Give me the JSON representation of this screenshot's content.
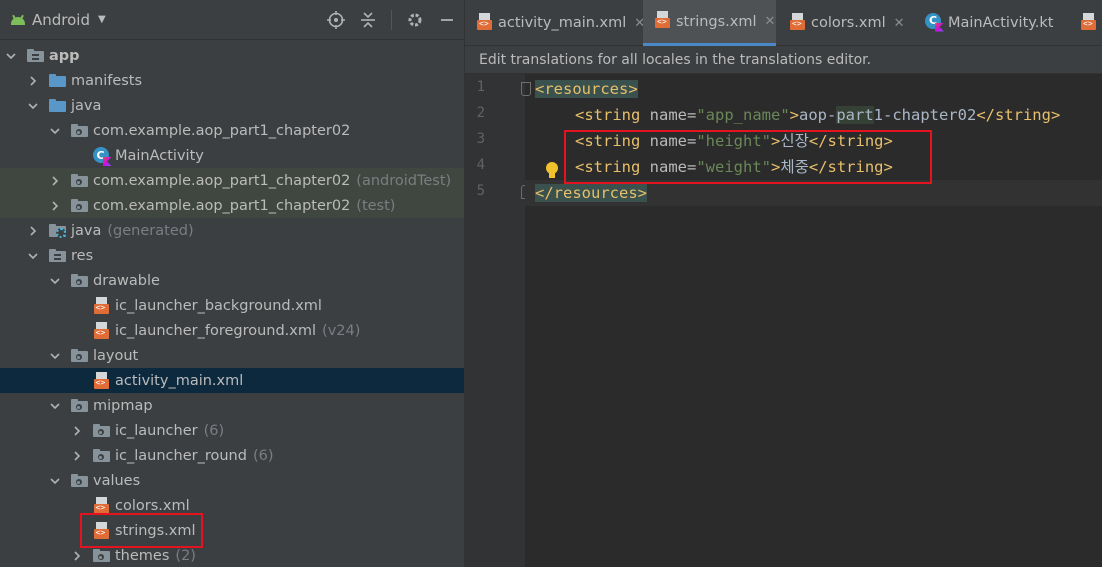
{
  "project_panel": {
    "view_label": "Android",
    "tree": [
      {
        "label": "app",
        "hint": "",
        "icon": "module-folder-icon",
        "depth": 0,
        "expanded": true,
        "bold": true
      },
      {
        "label": "manifests",
        "hint": "",
        "icon": "folder-icon",
        "depth": 1,
        "expanded": false
      },
      {
        "label": "java",
        "hint": "",
        "icon": "source-folder-icon",
        "depth": 1,
        "expanded": true
      },
      {
        "label": "com.example.aop_part1_chapter02",
        "hint": "",
        "icon": "package-icon",
        "depth": 2,
        "expanded": true
      },
      {
        "label": "MainActivity",
        "hint": "",
        "icon": "kotlin-class-icon",
        "depth": 3,
        "leaf": true
      },
      {
        "label": "com.example.aop_part1_chapter02",
        "hint": "(androidTest)",
        "icon": "package-icon",
        "depth": 2,
        "expanded": false,
        "test": true
      },
      {
        "label": "com.example.aop_part1_chapter02",
        "hint": "(test)",
        "icon": "package-icon",
        "depth": 2,
        "expanded": false,
        "test": true
      },
      {
        "label": "java",
        "hint": "(generated)",
        "icon": "generated-folder-icon",
        "depth": 1,
        "expanded": false
      },
      {
        "label": "res",
        "hint": "",
        "icon": "resources-folder-icon",
        "depth": 1,
        "expanded": true
      },
      {
        "label": "drawable",
        "hint": "",
        "icon": "package-icon",
        "depth": 2,
        "expanded": true
      },
      {
        "label": "ic_launcher_background.xml",
        "hint": "",
        "icon": "xml-file-icon",
        "depth": 3,
        "leaf": true
      },
      {
        "label": "ic_launcher_foreground.xml",
        "hint": "(v24)",
        "icon": "xml-file-icon",
        "depth": 3,
        "leaf": true
      },
      {
        "label": "layout",
        "hint": "",
        "icon": "package-icon",
        "depth": 2,
        "expanded": true
      },
      {
        "label": "activity_main.xml",
        "hint": "",
        "icon": "xml-file-icon",
        "depth": 3,
        "leaf": true,
        "selected": true
      },
      {
        "label": "mipmap",
        "hint": "",
        "icon": "package-icon",
        "depth": 2,
        "expanded": true
      },
      {
        "label": "ic_launcher",
        "hint": "(6)",
        "icon": "package-icon",
        "depth": 3,
        "expanded": false
      },
      {
        "label": "ic_launcher_round",
        "hint": "(6)",
        "icon": "package-icon",
        "depth": 3,
        "expanded": false
      },
      {
        "label": "values",
        "hint": "",
        "icon": "package-icon",
        "depth": 2,
        "expanded": true
      },
      {
        "label": "colors.xml",
        "hint": "",
        "icon": "xml-file-icon",
        "depth": 3,
        "leaf": true
      },
      {
        "label": "strings.xml",
        "hint": "",
        "icon": "xml-file-icon",
        "depth": 3,
        "leaf": true,
        "highlighted": true
      },
      {
        "label": "themes",
        "hint": "(2)",
        "icon": "package-icon",
        "depth": 3,
        "expanded": false
      }
    ]
  },
  "editor": {
    "tabs": [
      {
        "label": "activity_main.xml",
        "icon": "xml-file-icon",
        "active": false,
        "closable": true
      },
      {
        "label": "strings.xml",
        "icon": "xml-file-icon",
        "active": true,
        "closable": true
      },
      {
        "label": "colors.xml",
        "icon": "xml-file-icon",
        "active": false,
        "closable": true
      },
      {
        "label": "MainActivity.kt",
        "icon": "kotlin-class-icon",
        "active": false,
        "closable": false
      },
      {
        "label": "",
        "icon": "xml-file-icon",
        "active": false,
        "closable": false
      }
    ],
    "banner": "Edit translations for all locales in the translations editor.",
    "line_numbers": [
      "1",
      "2",
      "3",
      "4",
      "5"
    ],
    "code": {
      "line1_tag": "<resources>",
      "line2_open": "<string ",
      "line2_attr": "name=",
      "line2_val": "\"app_name\"",
      "line2_gt": ">",
      "line2_text_a": "aop-",
      "line2_text_b": "part",
      "line2_text_c": "1-chapter02",
      "line2_close": "</string>",
      "line3_open": "<string ",
      "line3_attr": "name=",
      "line3_val": "\"height\"",
      "line3_gt": ">",
      "line3_text": "신장",
      "line3_close": "</string>",
      "line4_open": "<string ",
      "line4_attr": "name=",
      "line4_val": "\"weight\"",
      "line4_gt": ">",
      "line4_text": "체중",
      "line4_close": "</string>",
      "line5_tag": "</resources>"
    }
  },
  "colors": {
    "highlight_box": "#e3141f",
    "accent": "#4a88c7"
  }
}
